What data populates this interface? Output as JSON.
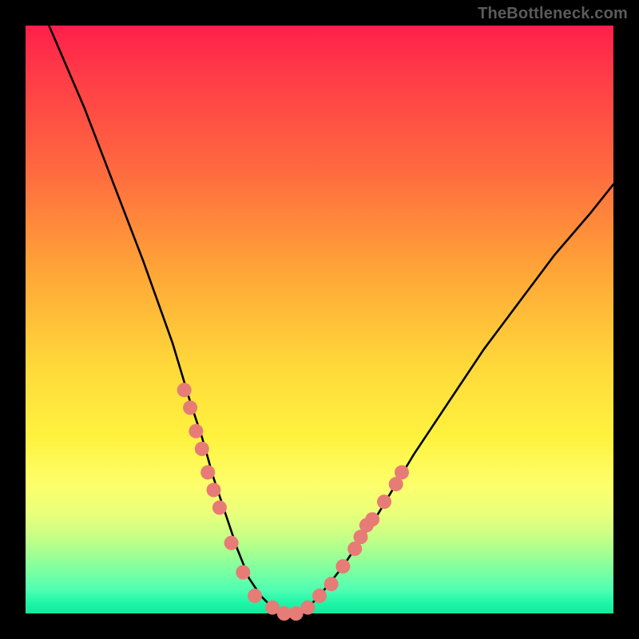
{
  "watermark": "TheBottleneck.com",
  "colors": {
    "frame": "#000000",
    "curve": "#000000",
    "markers": "#e77b76",
    "gradient_top": "#ff1f4b",
    "gradient_bottom": "#12e89c"
  },
  "chart_data": {
    "type": "line",
    "title": "",
    "xlabel": "",
    "ylabel": "",
    "xlim": [
      0,
      100
    ],
    "ylim": [
      0,
      100
    ],
    "grid": false,
    "legend": false,
    "series": [
      {
        "name": "curve",
        "x": [
          4,
          10,
          15,
          20,
          25,
          28,
          30,
          32,
          34,
          36,
          38,
          40,
          42,
          44,
          46,
          48,
          50,
          54,
          60,
          66,
          72,
          78,
          84,
          90,
          96,
          100
        ],
        "y": [
          100,
          86,
          73,
          60,
          46,
          36,
          30,
          23,
          17,
          11,
          6,
          3,
          1,
          0,
          0,
          1,
          3,
          8,
          17,
          27,
          36,
          45,
          53,
          61,
          68,
          73
        ]
      }
    ],
    "markers": {
      "name": "highlight-dots",
      "color": "#e77b76",
      "points": [
        {
          "x": 27,
          "y": 38
        },
        {
          "x": 28,
          "y": 35
        },
        {
          "x": 29,
          "y": 31
        },
        {
          "x": 30,
          "y": 28
        },
        {
          "x": 31,
          "y": 24
        },
        {
          "x": 32,
          "y": 21
        },
        {
          "x": 33,
          "y": 18
        },
        {
          "x": 35,
          "y": 12
        },
        {
          "x": 37,
          "y": 7
        },
        {
          "x": 39,
          "y": 3
        },
        {
          "x": 42,
          "y": 1
        },
        {
          "x": 44,
          "y": 0
        },
        {
          "x": 46,
          "y": 0
        },
        {
          "x": 48,
          "y": 1
        },
        {
          "x": 50,
          "y": 3
        },
        {
          "x": 52,
          "y": 5
        },
        {
          "x": 54,
          "y": 8
        },
        {
          "x": 56,
          "y": 11
        },
        {
          "x": 57,
          "y": 13
        },
        {
          "x": 58,
          "y": 15
        },
        {
          "x": 59,
          "y": 16
        },
        {
          "x": 61,
          "y": 19
        },
        {
          "x": 63,
          "y": 22
        },
        {
          "x": 64,
          "y": 24
        }
      ]
    }
  }
}
